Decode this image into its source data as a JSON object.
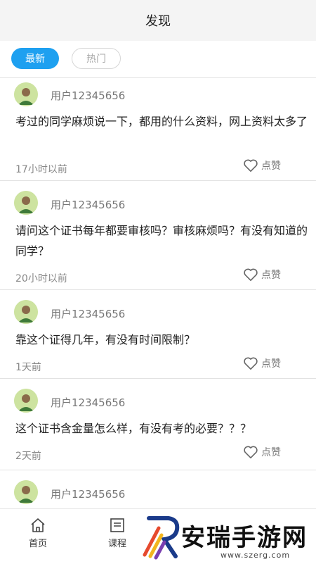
{
  "header": {
    "title": "发现"
  },
  "tabs": [
    {
      "label": "最新",
      "active": true
    },
    {
      "label": "热门",
      "active": false
    }
  ],
  "posts": [
    {
      "username": "用户12345656",
      "content": "考过的同学麻烦说一下，都用的什么资料，网上资料太多了",
      "time": "17小时以前",
      "like_label": "点赞"
    },
    {
      "username": "用户12345656",
      "content": "请问这个证书每年都要审核吗？审核麻烦吗？有没有知道的同学？",
      "time": "20小时以前",
      "like_label": "点赞"
    },
    {
      "username": "用户12345656",
      "content": "靠这个证得几年，有没有时间限制？",
      "time": "1天前",
      "like_label": "点赞"
    },
    {
      "username": "用户12345656",
      "content": "这个证书含金量怎么样，有没有考的必要？？？",
      "time": "2天前",
      "like_label": "点赞"
    },
    {
      "username": "用户12345656"
    }
  ],
  "bottom_nav": [
    {
      "label": "首页",
      "icon": "home-icon"
    },
    {
      "label": "课程",
      "icon": "course-book-icon"
    }
  ],
  "watermark": {
    "text": "安瑞手游网",
    "url": "www.szerg.com"
  },
  "colors": {
    "accent": "#1ea0f0",
    "header_bg": "#f4f4f4",
    "divider": "#e2e2e2"
  }
}
